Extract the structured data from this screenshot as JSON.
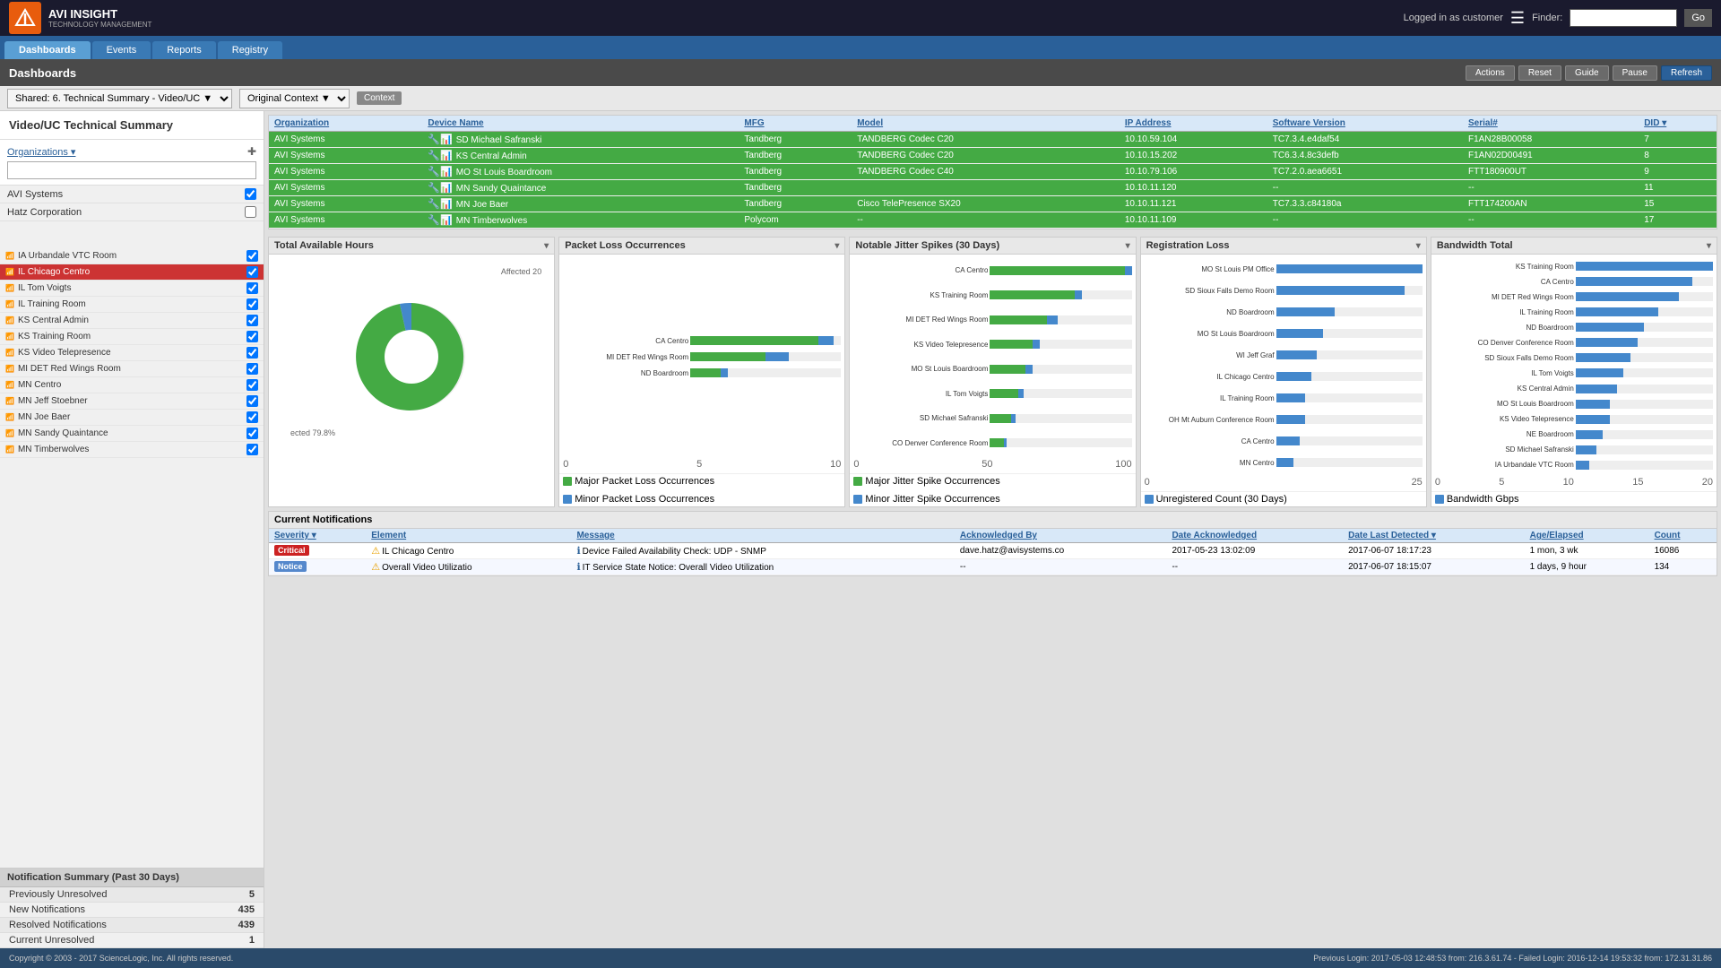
{
  "app": {
    "title": "AVI INSIGHT",
    "subtitle": "TECHNOLOGY MANAGEMENT",
    "logged_in": "Logged in as customer",
    "finder_label": "Finder:",
    "go_label": "Go"
  },
  "nav": {
    "tabs": [
      "Dashboards",
      "Events",
      "Reports",
      "Registry"
    ],
    "active": "Dashboards"
  },
  "toolbar": {
    "title": "Dashboards",
    "buttons": [
      "Actions",
      "Reset",
      "Guide",
      "Pause",
      "Refresh"
    ],
    "dropdown1": "Shared: 6. Technical Summary - Video/UC",
    "dropdown2": "Original Context",
    "context_btn": "Context"
  },
  "left_panel": {
    "title": "Video/UC Technical Summary",
    "org_label": "Organizations",
    "orgs": [
      {
        "name": "AVI Systems",
        "checked": true
      },
      {
        "name": "Hatz Corporation",
        "checked": false
      }
    ],
    "devices": [
      {
        "name": "IA Urbandale VTC Room",
        "state": "normal",
        "checked": true
      },
      {
        "name": "IL Chicago Centro",
        "state": "red",
        "checked": true
      },
      {
        "name": "IL Tom Voigts",
        "state": "normal",
        "checked": true
      },
      {
        "name": "IL Training Room",
        "state": "normal",
        "checked": true
      },
      {
        "name": "KS Central Admin",
        "state": "normal",
        "checked": true
      },
      {
        "name": "KS Training Room",
        "state": "normal",
        "checked": true
      },
      {
        "name": "KS Video Telepresence",
        "state": "normal",
        "checked": true
      },
      {
        "name": "MI DET Red Wings Room",
        "state": "normal",
        "checked": true
      },
      {
        "name": "MN Centro",
        "state": "normal",
        "checked": true
      },
      {
        "name": "MN Jeff Stoebner",
        "state": "normal",
        "checked": true
      },
      {
        "name": "MN Joe Baer",
        "state": "normal",
        "checked": true
      },
      {
        "name": "MN Sandy Quaintance",
        "state": "normal",
        "checked": true
      },
      {
        "name": "MN Timberwolves",
        "state": "normal",
        "checked": true
      }
    ],
    "notification_summary": {
      "title": "Notification Summary (Past 30 Days)",
      "rows": [
        {
          "label": "Previously Unresolved",
          "value": "5"
        },
        {
          "label": "New Notifications",
          "value": "435"
        },
        {
          "label": "Resolved Notifications",
          "value": "439"
        },
        {
          "label": "Current Unresolved",
          "value": "1"
        }
      ]
    }
  },
  "device_table": {
    "headers": [
      "Organization",
      "Device Name",
      "MFG",
      "Model",
      "IP Address",
      "Software Version",
      "Serial#",
      "DID"
    ],
    "rows": [
      {
        "org": "AVI Systems",
        "name": "SD Michael Safranski",
        "mfg": "Tandberg",
        "model": "TANDBERG Codec C20",
        "ip": "10.10.59.104",
        "sw": "TC7.3.4.e4daf54",
        "serial": "F1AN28B00058",
        "did": "7",
        "color": "green"
      },
      {
        "org": "AVI Systems",
        "name": "KS Central Admin",
        "mfg": "Tandberg",
        "model": "TANDBERG Codec C20",
        "ip": "10.10.15.202",
        "sw": "TC6.3.4.8c3defb",
        "serial": "F1AN02D00491",
        "did": "8",
        "color": "green"
      },
      {
        "org": "AVI Systems",
        "name": "MO St Louis Boardroom",
        "mfg": "Tandberg",
        "model": "TANDBERG Codec C40",
        "ip": "10.10.79.106",
        "sw": "TC7.2.0.aea6651",
        "serial": "FTT180900UT",
        "did": "9",
        "color": "green"
      },
      {
        "org": "AVI Systems",
        "name": "MN Sandy Quaintance",
        "mfg": "Tandberg",
        "model": "",
        "ip": "10.10.11.120",
        "sw": "--",
        "serial": "--",
        "did": "11",
        "color": "green"
      },
      {
        "org": "AVI Systems",
        "name": "MN Joe Baer",
        "mfg": "Tandberg",
        "model": "Cisco TelePresence SX20",
        "ip": "10.10.11.121",
        "sw": "TC7.3.3.c84180a",
        "serial": "FTT174200AN",
        "did": "15",
        "color": "green"
      },
      {
        "org": "AVI Systems",
        "name": "MN Timberwolves",
        "mfg": "Polycom",
        "model": "--",
        "ip": "10.10.11.109",
        "sw": "--",
        "serial": "--",
        "did": "17",
        "color": "green"
      }
    ]
  },
  "charts": {
    "total_available": {
      "title": "Total Available Hours",
      "pie_pct": "79.8%",
      "affected_pct": "Affected 20"
    },
    "packet_loss": {
      "title": "Packet Loss Occurrences",
      "bars": [
        {
          "label": "CA Centro",
          "major": 85,
          "minor": 10
        },
        {
          "label": "MI DET Red Wings Room",
          "major": 50,
          "minor": 15
        },
        {
          "label": "ND Boardroom",
          "major": 20,
          "minor": 5
        }
      ],
      "axis": [
        "0",
        "5",
        "10"
      ],
      "legend": [
        "Major Packet Loss Occurrences",
        "Minor Packet Loss Occurrences"
      ]
    },
    "jitter_spikes": {
      "title": "Notable Jitter Spikes (30 Days)",
      "bars": [
        {
          "label": "CA Centro",
          "major": 100,
          "minor": 10
        },
        {
          "label": "KS Training Room",
          "major": 60,
          "minor": 5
        },
        {
          "label": "MI DET Red Wings Room",
          "major": 40,
          "minor": 8
        },
        {
          "label": "KS Video Telepresence",
          "major": 30,
          "minor": 5
        },
        {
          "label": "MO St Louis Boardroom",
          "major": 25,
          "minor": 5
        },
        {
          "label": "IL Tom Voigts",
          "major": 20,
          "minor": 4
        },
        {
          "label": "SD Michael Safranski",
          "major": 15,
          "minor": 3
        },
        {
          "label": "CO Denver Conference Room",
          "major": 10,
          "minor": 2
        }
      ],
      "axis": [
        "0",
        "50",
        "100"
      ],
      "legend": [
        "Major Jitter Spike Occurrences",
        "Minor Jitter Spike Occurrences"
      ]
    },
    "registration_loss": {
      "title": "Registration Loss",
      "bars": [
        {
          "label": "MO St Louis PM Office",
          "value": 25
        },
        {
          "label": "SD Sioux Falls Demo Room",
          "value": 22
        },
        {
          "label": "ND Boardroom",
          "value": 10
        },
        {
          "label": "MO St Louis Boardroom",
          "value": 8
        },
        {
          "label": "WI Jeff Graf",
          "value": 7
        },
        {
          "label": "IL Chicago Centro",
          "value": 6
        },
        {
          "label": "IL Training Room",
          "value": 5
        },
        {
          "label": "OH Mt Auburn Conference Room",
          "value": 5
        },
        {
          "label": "CA Centro",
          "value": 4
        },
        {
          "label": "MN Centro",
          "value": 3
        }
      ],
      "axis": [
        "0",
        "25"
      ],
      "legend": [
        "Unregistered Count (30 Days)"
      ]
    },
    "bandwidth": {
      "title": "Bandwidth Total",
      "bars": [
        {
          "label": "KS Training Room",
          "value": 20
        },
        {
          "label": "CA Centro",
          "value": 17
        },
        {
          "label": "MI DET Red Wings Room",
          "value": 15
        },
        {
          "label": "IL Training Room",
          "value": 12
        },
        {
          "label": "ND Boardroom",
          "value": 10
        },
        {
          "label": "CO Denver Conference Room",
          "value": 9
        },
        {
          "label": "SD Sioux Falls Demo Room",
          "value": 8
        },
        {
          "label": "IL Tom Voigts",
          "value": 7
        },
        {
          "label": "KS Central Admin",
          "value": 6
        },
        {
          "label": "MO St Louis Boardroom",
          "value": 5
        },
        {
          "label": "KS Video Telepresence",
          "value": 5
        },
        {
          "label": "NE Boardroom",
          "value": 4
        },
        {
          "label": "SD Michael Safranski",
          "value": 3
        },
        {
          "label": "IA Urbandale VTC Room",
          "value": 2
        }
      ],
      "axis": [
        "0",
        "5",
        "10",
        "15",
        "20"
      ],
      "legend": [
        "Bandwidth Gbps"
      ]
    }
  },
  "notifications": {
    "title": "Current Notifications",
    "headers": [
      "Severity",
      "Element",
      "Message",
      "Acknowledged By",
      "Date Acknowledged",
      "Date Last Detected",
      "Age/Elapsed",
      "Count"
    ],
    "rows": [
      {
        "severity": "Critical",
        "element": "IL Chicago Centro",
        "message": "Device Failed Availability Check: UDP - SNMP",
        "ack_by": "dave.hatz@avisystems.co",
        "date_ack": "2017-05-23 13:02:09",
        "date_detected": "2017-06-07 18:17:23",
        "age": "1 mon, 3 wk",
        "count": "16086"
      },
      {
        "severity": "Notice",
        "element": "Overall Video Utilizatio",
        "message": "IT Service State Notice: Overall Video Utilization",
        "ack_by": "--",
        "date_ack": "--",
        "date_detected": "2017-06-07 18:15:07",
        "age": "1 days, 9 hour",
        "count": "134"
      }
    ]
  },
  "footer": {
    "copyright": "Copyright © 2003 - 2017 ScienceLogic, Inc. All rights reserved.",
    "login_info": "Previous Login: 2017-05-03 12:48:53 from: 216.3.61.74 - Failed Login: 2016-12-14 19:53:32 from: 172.31.31.86"
  }
}
